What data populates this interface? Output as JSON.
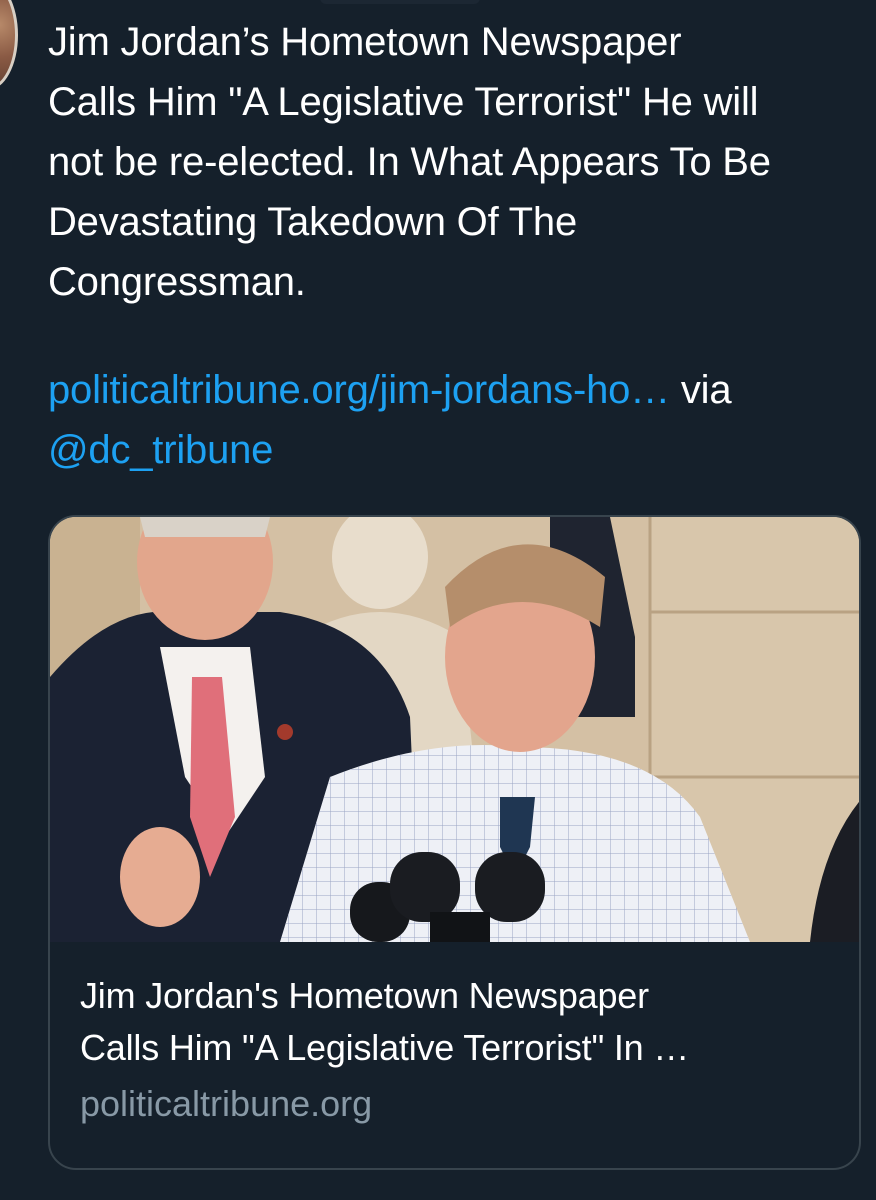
{
  "tweet": {
    "text_lines": [
      "Jim Jordan’s Hometown Newspaper",
      "Calls Him \"A Legislative Terrorist\" He will",
      "not be re-elected. In What Appears To Be",
      "Devastating Takedown Of The",
      "Congressman."
    ],
    "link_text": "politicaltribune.org/jim-jordans-ho…",
    "via_text": " via",
    "mention": "@dc_tribune"
  },
  "card": {
    "title_lines": [
      "Jim Jordan's Hometown Newspaper",
      "Calls Him \"A Legislative Terrorist\" In …"
    ],
    "domain": "politicaltribune.org"
  },
  "colors": {
    "background": "#15202b",
    "link": "#1da1f2",
    "secondary_text": "#8899a6",
    "card_border": "#38444d"
  }
}
